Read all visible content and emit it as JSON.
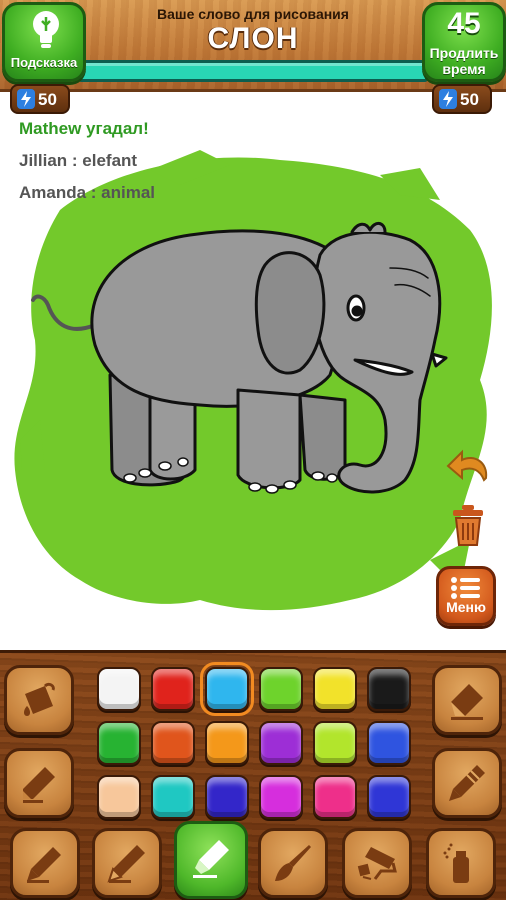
{
  "header": {
    "word_hint": "Ваше слово для рисования",
    "word": "СЛОН",
    "hint_button": {
      "label": "Подсказка",
      "icon": "lightbulb-icon",
      "cost": "50"
    },
    "extend_button": {
      "seconds": "45",
      "label_line1": "Продлить",
      "label_line2": "время",
      "cost": "50"
    },
    "timer_remaining_fraction": 1.0
  },
  "chat": [
    {
      "text": "Mathew угадал!",
      "color": "#2f9a22"
    },
    {
      "text": "Jillian : elefant",
      "color": "#555555"
    },
    {
      "text": "Amanda : animal",
      "color": "#555555"
    }
  ],
  "canvas": {
    "background_color": "#73c92b",
    "subject": "elephant"
  },
  "side_controls": {
    "undo_icon": "undo-arrow-icon",
    "trash_icon": "trash-icon",
    "menu_label": "Меню"
  },
  "palette": {
    "colors": [
      [
        "#f4f4f4",
        "#e0231c",
        "#2fb6ee",
        "#6ed32c",
        "#f2e22a",
        "#1a1a1a"
      ],
      [
        "#27b332",
        "#e0551c",
        "#f4981a",
        "#9d2ed6",
        "#b2e52c",
        "#2f54e0"
      ],
      [
        "#f7c79b",
        "#1fc8c2",
        "#3326c9",
        "#d62edd",
        "#ee2f8a",
        "#2f36d6"
      ]
    ],
    "selected_color": "#2fb6ee",
    "left_tools": [
      "paint-bucket-icon",
      "marker-icon"
    ],
    "right_tools": [
      "eraser-icon",
      "crayon-icon"
    ],
    "bottom_tools": [
      "pen-icon",
      "pencil-icon",
      "highlighter-icon",
      "paintbrush-icon",
      "paint-roller-icon",
      "spray-can-icon"
    ],
    "active_tool": "highlighter-icon"
  }
}
